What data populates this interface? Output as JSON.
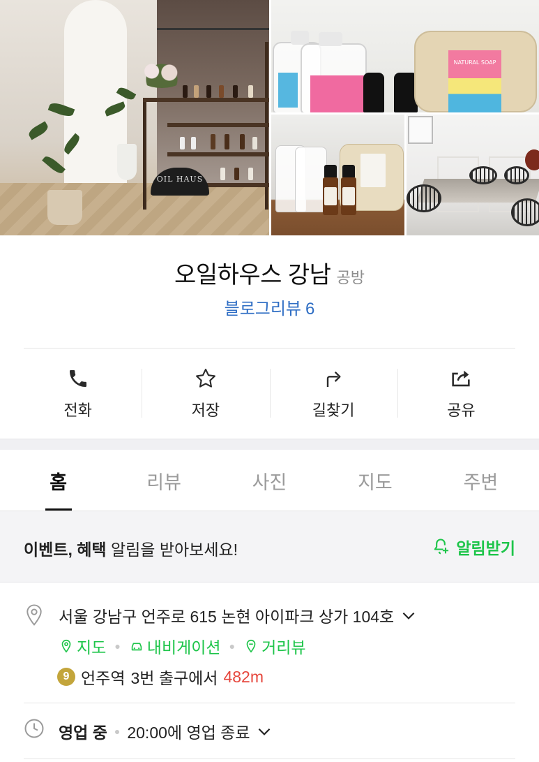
{
  "gallery": {
    "main_sign_text": "OIL HAUS",
    "soap_label_text": "NATURAL SOAP"
  },
  "place": {
    "name": "오일하우스 강남",
    "category": "공방",
    "blog_review_label": "블로그리뷰",
    "blog_review_count": "6"
  },
  "actions": [
    {
      "label": "전화",
      "icon": "phone-icon"
    },
    {
      "label": "저장",
      "icon": "star-icon"
    },
    {
      "label": "길찾기",
      "icon": "directions-icon"
    },
    {
      "label": "공유",
      "icon": "share-icon"
    }
  ],
  "tabs": [
    {
      "label": "홈",
      "active": true
    },
    {
      "label": "리뷰",
      "active": false
    },
    {
      "label": "사진",
      "active": false
    },
    {
      "label": "지도",
      "active": false
    },
    {
      "label": "주변",
      "active": false
    }
  ],
  "event_banner": {
    "bold_text": "이벤트, 혜택",
    "text": " 알림을 받아보세요!",
    "button_label": "알림받기"
  },
  "address": {
    "text": "서울 강남구 언주로 615 논현 아이파크 상가 104호",
    "links": [
      "지도",
      "내비게이션",
      "거리뷰"
    ],
    "subway_line": "9",
    "station": "언주역",
    "exit_text": "3번 출구에서",
    "distance": "482m"
  },
  "hours": {
    "status": "영업 중",
    "close_text": "20:00에 영업 종료"
  },
  "colors": {
    "accent_green": "#1ec54a",
    "link_blue": "#2f6ec4",
    "distance_red": "#e6463c",
    "line9_gold": "#c3a53b"
  }
}
